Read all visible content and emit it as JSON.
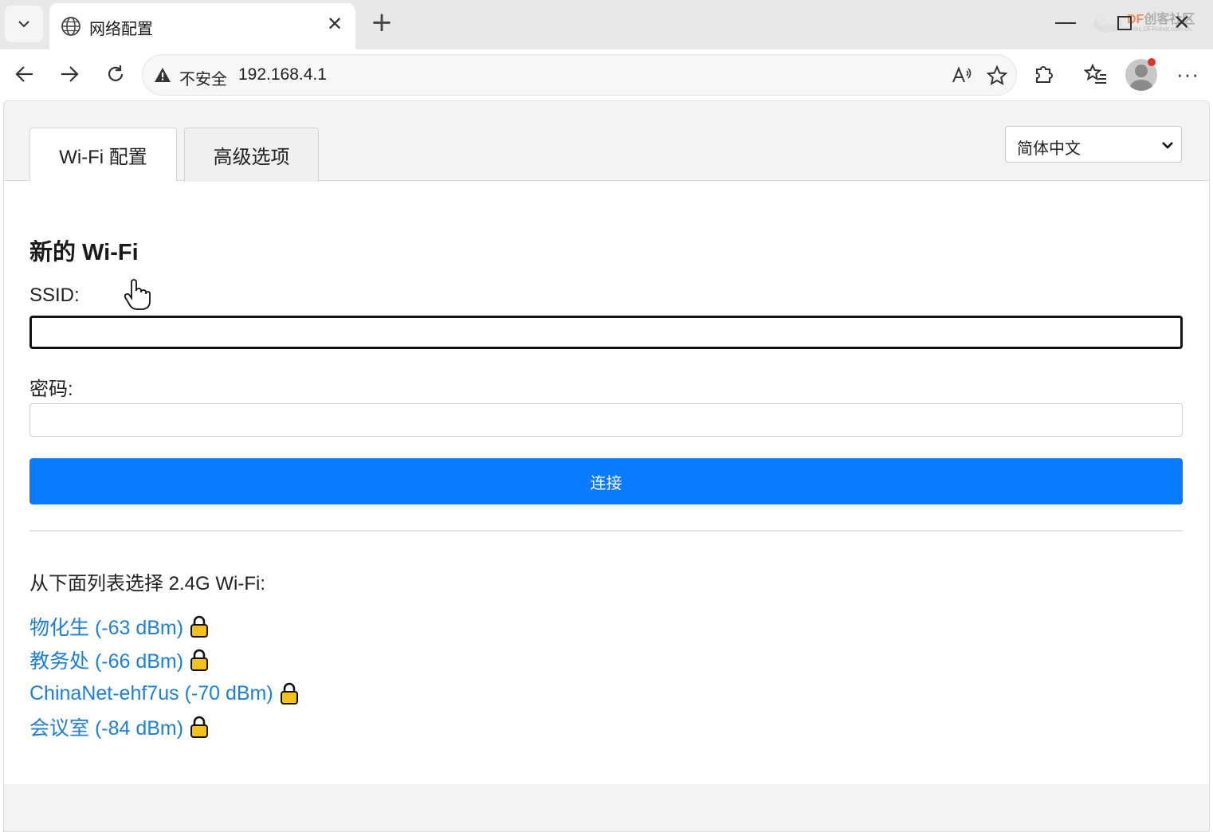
{
  "browser": {
    "tab_title": "网络配置",
    "new_tab_symbol": "+",
    "close_symbol": "✕",
    "address": {
      "security_label": "不安全",
      "url": "192.168.4.1"
    },
    "more_symbol": "···",
    "watermark": {
      "text_a": "DF",
      "text_b": "创客社区",
      "sub": "mc.DFRobot.com.cn"
    }
  },
  "page": {
    "tabs": [
      {
        "label": "Wi-Fi 配置",
        "active": true
      },
      {
        "label": "高级选项",
        "active": false
      }
    ],
    "language": {
      "selected": "简体中文"
    },
    "section_title": "新的 Wi-Fi",
    "ssid": {
      "label": "SSID:",
      "value": ""
    },
    "password": {
      "label": "密码:",
      "value": ""
    },
    "connect_button": "连接",
    "list_heading": "从下面列表选择 2.4G Wi-Fi:",
    "networks": [
      {
        "label": "物化生 (-63 dBm)",
        "locked": true
      },
      {
        "label": "教务处 (-66 dBm)",
        "locked": true
      },
      {
        "label": "ChinaNet-ehf7us (-70 dBm)",
        "locked": true
      },
      {
        "label": "会议室 (-84 dBm)",
        "locked": true
      }
    ]
  },
  "colors": {
    "accent": "#0a7aff",
    "link": "#1f7fd6",
    "lock": "#f2c21b"
  }
}
